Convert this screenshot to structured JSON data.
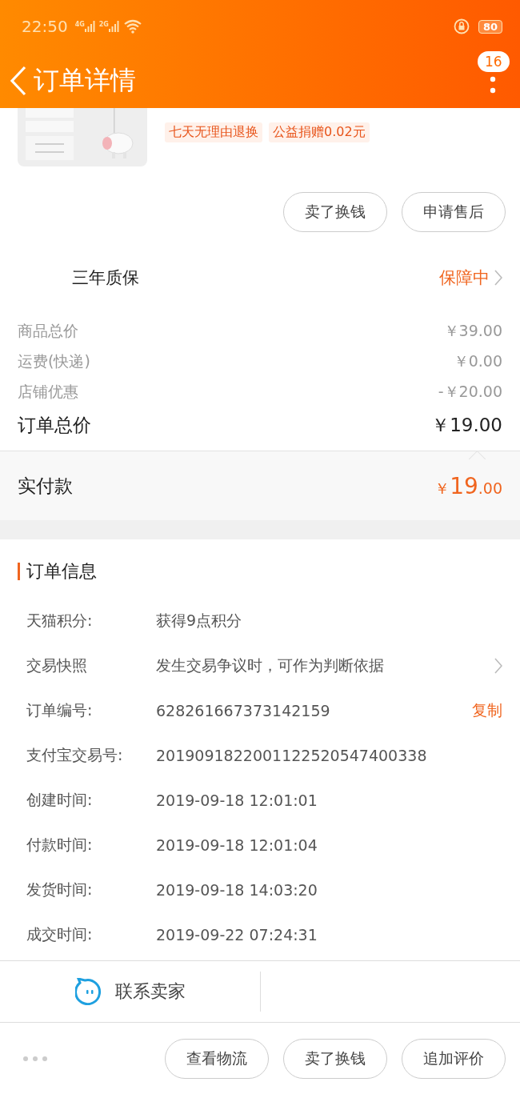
{
  "status_bar": {
    "time": "22:50",
    "networks": [
      "4G",
      "2G"
    ],
    "battery": "80"
  },
  "header": {
    "title": "订单详情",
    "badge": "16"
  },
  "product": {
    "image": {
      "kind": "picture"
    },
    "tags": [
      "七天无理由退换",
      "公益捐赠0.02元"
    ],
    "buttons": [
      "卖了换钱",
      "申请售后"
    ]
  },
  "warranty": {
    "label": "三年质保",
    "status": "保障中"
  },
  "prices": [
    {
      "label": "商品总价",
      "value": "￥39.00",
      "kind": "minor"
    },
    {
      "label": "运费(快递)",
      "value": "￥0.00",
      "kind": "minor"
    },
    {
      "label": "店铺优惠",
      "value": "-￥20.00",
      "kind": "minor"
    },
    {
      "label": "订单总价",
      "value": "￥19.00",
      "kind": "total"
    }
  ],
  "paid": {
    "label": "实付款",
    "currency": "￥",
    "integer": "19",
    "decimal": ".00"
  },
  "order_info": {
    "title": "订单信息",
    "rows": [
      {
        "label": "天猫积分:",
        "value": "获得9点积分",
        "kind": "plain"
      },
      {
        "label": "交易快照",
        "value": "发生交易争议时，可作为判断依据",
        "kind": "link"
      },
      {
        "label": "订单编号:",
        "value": "628261667373142159",
        "kind": "copy",
        "action": "复制"
      },
      {
        "label": "支付宝交易号:",
        "value": "2019091822001122520547400338",
        "kind": "plain"
      },
      {
        "label": "创建时间:",
        "value": "2019-09-18 12:01:01",
        "kind": "plain"
      },
      {
        "label": "付款时间:",
        "value": "2019-09-18 12:01:04",
        "kind": "plain"
      },
      {
        "label": "发货时间:",
        "value": "2019-09-18 14:03:20",
        "kind": "plain"
      },
      {
        "label": "成交时间:",
        "value": "2019-09-22 07:24:31",
        "kind": "plain"
      }
    ]
  },
  "contact": {
    "label": "联系卖家"
  },
  "bottom_buttons": [
    "查看物流",
    "卖了换钱",
    "追加评价"
  ]
}
